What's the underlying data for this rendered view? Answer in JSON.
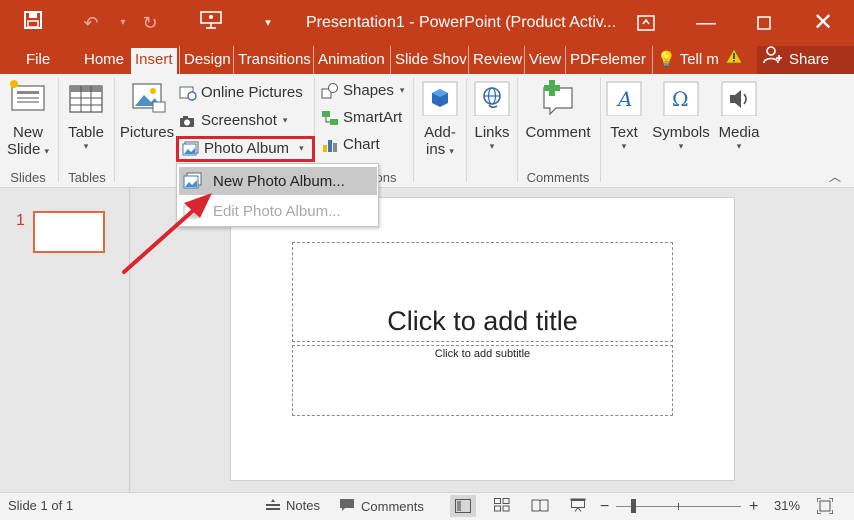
{
  "titlebar": {
    "title": "Presentation1 - PowerPoint (Product Activ...",
    "quick_access": [
      "save-icon",
      "undo-icon",
      "redo-icon",
      "presenter-icon",
      "customize-icon"
    ],
    "window_controls": [
      "ribbon-display-icon",
      "minimize-icon",
      "maximize-icon",
      "close-icon"
    ]
  },
  "tabs": [
    {
      "label": "File"
    },
    {
      "label": "Home"
    },
    {
      "label": "Insert"
    },
    {
      "label": "Design"
    },
    {
      "label": "Transitions"
    },
    {
      "label": "Animation"
    },
    {
      "label": "Slide Shov"
    },
    {
      "label": "Review"
    },
    {
      "label": "View"
    },
    {
      "label": "PDFelemer"
    }
  ],
  "tell_me": "Tell m",
  "share": "Share",
  "ribbon": {
    "new_slide": {
      "line1": "New",
      "line2": "Slide"
    },
    "table": "Table",
    "pictures": "Pictures",
    "online_pictures": "Online Pictures",
    "screenshot": "Screenshot",
    "photo_album": "Photo Album",
    "shapes": "Shapes",
    "smartart": "SmartArt",
    "chart": "Chart",
    "addins": {
      "line1": "Add-",
      "line2": "ins"
    },
    "links": "Links",
    "comment": "Comment",
    "text": "Text",
    "symbols": "Symbols",
    "media": "Media",
    "groups": {
      "slides": "Slides",
      "tables": "Tables",
      "illustrations_partial": "ons",
      "comments": "Comments"
    }
  },
  "dropdown": {
    "new_photo_album": "New Photo Album...",
    "edit_photo_album": "Edit Photo Album..."
  },
  "thumbnail": {
    "number": "1"
  },
  "slide": {
    "title_placeholder": "Click to add title",
    "subtitle_placeholder": "Click to add subtitle"
  },
  "statusbar": {
    "slide_info": "Slide 1 of 1",
    "notes": "Notes",
    "comments": "Comments",
    "zoom": "31%"
  },
  "colors": {
    "accent": "#c43e1c",
    "highlight": "#d9262e"
  }
}
